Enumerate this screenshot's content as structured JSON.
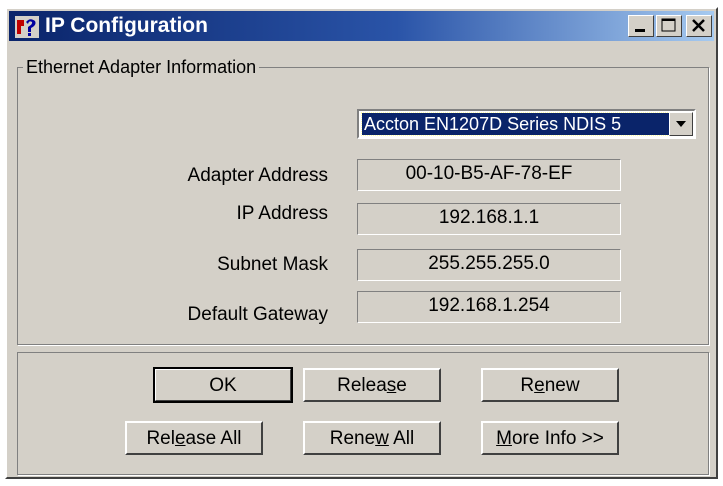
{
  "window": {
    "title": "IP Configuration",
    "icon": "network-config-icon",
    "controls": [
      "minimize-icon",
      "maximize-icon",
      "close-icon"
    ]
  },
  "group": {
    "legend": "Ethernet  Adapter Information"
  },
  "adapter_select": {
    "selected": "Accton EN1207D Series NDIS 5"
  },
  "fields": {
    "adapter_address": {
      "label": "Adapter Address",
      "value": "00-10-B5-AF-78-EF"
    },
    "ip_address": {
      "label": "IP Address",
      "value": "192.168.1.1"
    },
    "subnet_mask": {
      "label": "Subnet Mask",
      "value": "255.255.255.0"
    },
    "default_gateway": {
      "label": "Default Gateway",
      "value": "192.168.1.254"
    }
  },
  "buttons": {
    "ok": {
      "pre": "OK",
      "u": "",
      "post": ""
    },
    "release": {
      "pre": "Relea",
      "u": "s",
      "post": "e"
    },
    "renew": {
      "pre": "R",
      "u": "e",
      "post": "new"
    },
    "release_all": {
      "pre": "Rel",
      "u": "e",
      "post": "ase All"
    },
    "renew_all": {
      "pre": "Rene",
      "u": "w",
      "post": " All"
    },
    "more_info": {
      "pre": "",
      "u": "M",
      "post": "ore Info >>"
    }
  },
  "colors": {
    "titlebar_start": "#0a246a",
    "titlebar_end": "#a6caf0",
    "face": "#d4d0c8",
    "selection": "#0a246a"
  }
}
